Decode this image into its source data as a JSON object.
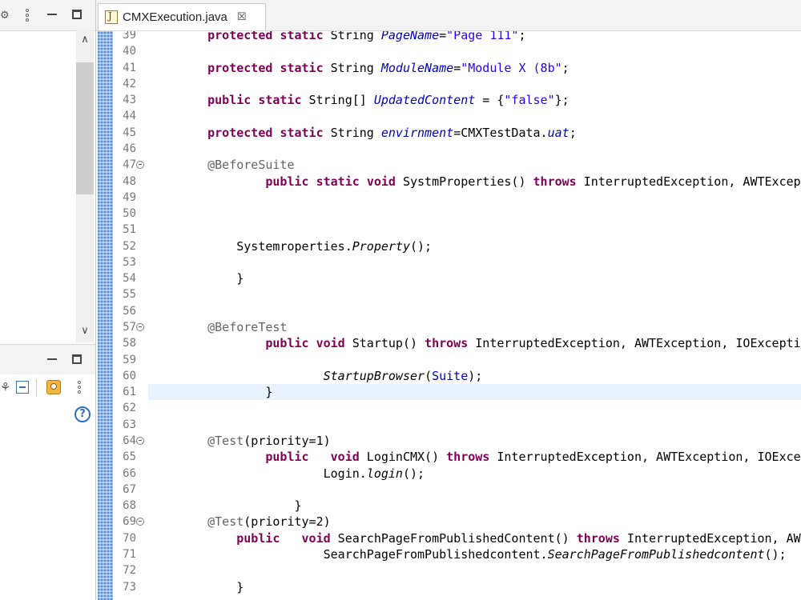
{
  "tab": {
    "title": "CMXExecution.java",
    "close": "☒"
  },
  "left_panel": {
    "help": "?",
    "scroll_up": "∧",
    "scroll_down": "∨"
  },
  "editor": {
    "current_line": 61,
    "lines": [
      {
        "n": "39",
        "fold": false,
        "tokens": [
          [
            "    ",
            ""
          ],
          [
            "protected",
            "kw"
          ],
          [
            " ",
            ""
          ],
          [
            "static",
            "kw"
          ],
          [
            " String ",
            ""
          ],
          [
            "PageName",
            "fld"
          ],
          [
            "=",
            ""
          ],
          [
            "\"Page 111\"",
            "str"
          ],
          [
            ";",
            ""
          ]
        ]
      },
      {
        "n": "40",
        "fold": false,
        "tokens": []
      },
      {
        "n": "41",
        "fold": false,
        "tokens": [
          [
            "    ",
            ""
          ],
          [
            "protected",
            "kw"
          ],
          [
            " ",
            ""
          ],
          [
            "static",
            "kw"
          ],
          [
            " String ",
            ""
          ],
          [
            "ModuleName",
            "fld"
          ],
          [
            "=",
            ""
          ],
          [
            "\"Module X (8b\"",
            "str"
          ],
          [
            ";",
            ""
          ]
        ]
      },
      {
        "n": "42",
        "fold": false,
        "tokens": []
      },
      {
        "n": "43",
        "fold": false,
        "tokens": [
          [
            "    ",
            ""
          ],
          [
            "public",
            "kw"
          ],
          [
            " ",
            ""
          ],
          [
            "static",
            "kw"
          ],
          [
            " String[] ",
            ""
          ],
          [
            "UpdatedContent",
            "fld"
          ],
          [
            " = {",
            ""
          ],
          [
            "\"false\"",
            "str"
          ],
          [
            "};",
            ""
          ]
        ]
      },
      {
        "n": "44",
        "fold": false,
        "tokens": []
      },
      {
        "n": "45",
        "fold": false,
        "tokens": [
          [
            "    ",
            ""
          ],
          [
            "protected",
            "kw"
          ],
          [
            " ",
            ""
          ],
          [
            "static",
            "kw"
          ],
          [
            " String ",
            ""
          ],
          [
            "envirnment",
            "fld"
          ],
          [
            "=CMXTestData.",
            ""
          ],
          [
            "uat",
            "fld"
          ],
          [
            ";",
            ""
          ]
        ]
      },
      {
        "n": "46",
        "fold": false,
        "tokens": []
      },
      {
        "n": "47",
        "fold": true,
        "tokens": [
          [
            "    ",
            ""
          ],
          [
            "@BeforeSuite",
            "ann"
          ]
        ]
      },
      {
        "n": "48",
        "fold": false,
        "tokens": [
          [
            "            ",
            ""
          ],
          [
            "public",
            "kw"
          ],
          [
            " ",
            ""
          ],
          [
            "static",
            "kw"
          ],
          [
            " ",
            ""
          ],
          [
            "void",
            "kw"
          ],
          [
            " SystmProperties() ",
            ""
          ],
          [
            "throws",
            "kw"
          ],
          [
            " InterruptedException, AWTException",
            ""
          ]
        ]
      },
      {
        "n": "49",
        "fold": false,
        "tokens": []
      },
      {
        "n": "50",
        "fold": false,
        "tokens": []
      },
      {
        "n": "51",
        "fold": false,
        "tokens": []
      },
      {
        "n": "52",
        "fold": false,
        "tokens": [
          [
            "        Systemroperties.",
            ""
          ],
          [
            "Property",
            "ital"
          ],
          [
            "();",
            ""
          ]
        ]
      },
      {
        "n": "53",
        "fold": false,
        "tokens": []
      },
      {
        "n": "54",
        "fold": false,
        "tokens": [
          [
            "        }",
            ""
          ]
        ]
      },
      {
        "n": "55",
        "fold": false,
        "tokens": []
      },
      {
        "n": "56",
        "fold": false,
        "tokens": []
      },
      {
        "n": "57",
        "fold": true,
        "tokens": [
          [
            "    ",
            ""
          ],
          [
            "@BeforeTest",
            "ann"
          ]
        ]
      },
      {
        "n": "58",
        "fold": false,
        "tokens": [
          [
            "            ",
            ""
          ],
          [
            "public",
            "kw"
          ],
          [
            " ",
            ""
          ],
          [
            "void",
            "kw"
          ],
          [
            " Startup() ",
            ""
          ],
          [
            "throws",
            "kw"
          ],
          [
            " InterruptedException, AWTException, IOException",
            ""
          ]
        ]
      },
      {
        "n": "59",
        "fold": false,
        "tokens": []
      },
      {
        "n": "60",
        "fold": false,
        "tokens": [
          [
            "                    ",
            ""
          ],
          [
            "StartupBrowser",
            "ital"
          ],
          [
            "(",
            ""
          ],
          [
            "Suite",
            "fldn"
          ],
          [
            ");",
            ""
          ]
        ]
      },
      {
        "n": "61",
        "fold": false,
        "tokens": [
          [
            "            }",
            ""
          ]
        ]
      },
      {
        "n": "62",
        "fold": false,
        "tokens": []
      },
      {
        "n": "63",
        "fold": false,
        "tokens": []
      },
      {
        "n": "64",
        "fold": true,
        "tokens": [
          [
            "    ",
            ""
          ],
          [
            "@Test",
            "ann"
          ],
          [
            "(priority=1)",
            ""
          ]
        ]
      },
      {
        "n": "65",
        "fold": false,
        "tokens": [
          [
            "            ",
            ""
          ],
          [
            "public",
            "kw"
          ],
          [
            "   ",
            ""
          ],
          [
            "void",
            "kw"
          ],
          [
            " LoginCMX() ",
            ""
          ],
          [
            "throws",
            "kw"
          ],
          [
            " InterruptedException, AWTException, IOException",
            ""
          ]
        ]
      },
      {
        "n": "66",
        "fold": false,
        "tokens": [
          [
            "                    Login.",
            ""
          ],
          [
            "login",
            "ital"
          ],
          [
            "();",
            ""
          ]
        ]
      },
      {
        "n": "67",
        "fold": false,
        "tokens": []
      },
      {
        "n": "68",
        "fold": false,
        "tokens": [
          [
            "                }",
            ""
          ]
        ]
      },
      {
        "n": "69",
        "fold": true,
        "tokens": [
          [
            "    ",
            ""
          ],
          [
            "@Test",
            "ann"
          ],
          [
            "(priority=2)",
            ""
          ]
        ]
      },
      {
        "n": "70",
        "fold": false,
        "tokens": [
          [
            "        ",
            ""
          ],
          [
            "public",
            "kw"
          ],
          [
            "   ",
            ""
          ],
          [
            "void",
            "kw"
          ],
          [
            " SearchPageFromPublishedContent() ",
            ""
          ],
          [
            "throws",
            "kw"
          ],
          [
            " InterruptedException, AWTException",
            ""
          ]
        ]
      },
      {
        "n": "71",
        "fold": false,
        "tokens": [
          [
            "                    SearchPageFromPublishedcontent.",
            ""
          ],
          [
            "SearchPageFromPublishedcontent",
            "ital"
          ],
          [
            "();",
            ""
          ]
        ]
      },
      {
        "n": "72",
        "fold": false,
        "tokens": []
      },
      {
        "n": "73",
        "fold": false,
        "tokens": [
          [
            "        }",
            ""
          ]
        ]
      }
    ]
  }
}
